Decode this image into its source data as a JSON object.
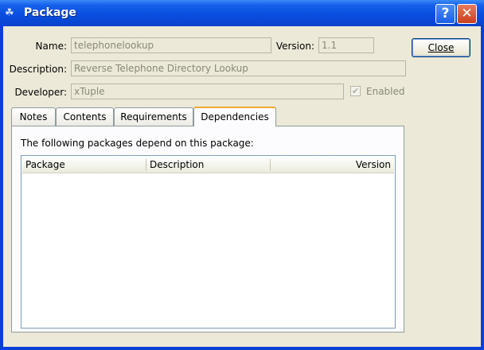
{
  "window": {
    "title": "Package",
    "help_label": "?",
    "close_label": "✕"
  },
  "form": {
    "name_label": "Name:",
    "name_value": "telephonelookup",
    "version_label": "Version:",
    "version_value": "1.1",
    "description_label": "Description:",
    "description_value": "Reverse Telephone Directory Lookup",
    "developer_label": "Developer:",
    "developer_value": "xTuple",
    "enabled_label": "Enabled",
    "enabled_checked": true,
    "close_button_label": "Close"
  },
  "tabs": [
    {
      "label": "Notes"
    },
    {
      "label": "Contents"
    },
    {
      "label": "Requirements"
    },
    {
      "label": "Dependencies",
      "active": true
    }
  ],
  "dependencies": {
    "intro_text": "The following packages depend on this package:",
    "columns": [
      "Package",
      "Description",
      "Version"
    ],
    "rows": []
  }
}
